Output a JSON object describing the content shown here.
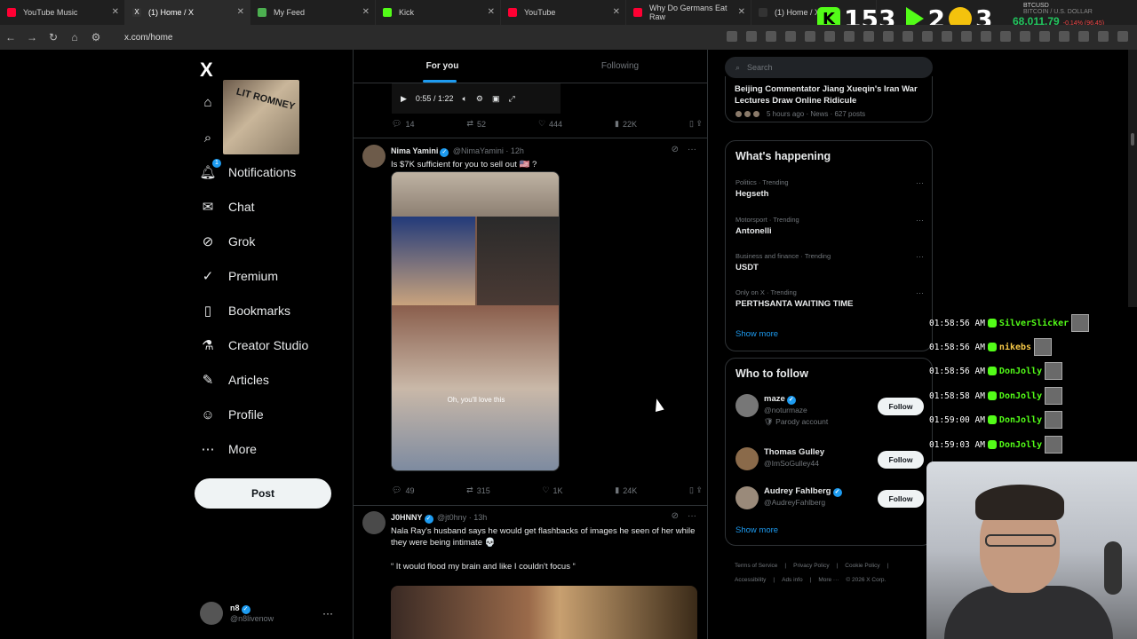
{
  "browser": {
    "tabs": [
      {
        "title": "YouTube Music",
        "color": "#ff0033"
      },
      {
        "title": "(1) Home / X",
        "color": "#e7e9ea"
      },
      {
        "title": "My Feed",
        "color": "#4caf50"
      },
      {
        "title": "Kick",
        "color": "#53fc18"
      },
      {
        "title": "YouTube",
        "color": "#ff0033"
      },
      {
        "title": "Why Do Germans Eat Raw",
        "color": "#ff0033"
      },
      {
        "title": "(1) Home / X",
        "color": "#e7e9ea"
      }
    ],
    "url": "x.com/home"
  },
  "stream_overlay": {
    "digits": "153",
    "count2": "2",
    "count3": "3",
    "btc_symbol": "BTCUSD",
    "btc_name": "BITCOIN / U.S. DOLLAR",
    "btc_price": "68,011.79",
    "btc_change": "-0.14% (96.45)"
  },
  "sidebar": {
    "logo": "X",
    "items": [
      {
        "label": "Notifications",
        "icon": "bell-icon",
        "badge": "1"
      },
      {
        "label": "Chat",
        "icon": "mail-icon"
      },
      {
        "label": "Grok",
        "icon": "grok-icon"
      },
      {
        "label": "Premium",
        "icon": "premium-icon"
      },
      {
        "label": "Bookmarks",
        "icon": "bookmark-icon"
      },
      {
        "label": "Creator Studio",
        "icon": "flask-icon"
      },
      {
        "label": "Articles",
        "icon": "article-icon"
      },
      {
        "label": "Profile",
        "icon": "person-icon"
      },
      {
        "label": "More",
        "icon": "more-circle-icon"
      }
    ],
    "overlay_image_text": "LIT ROMNEY",
    "post_button": "Post",
    "account": {
      "name": "n8",
      "handle": "@n8livenow"
    }
  },
  "feed": {
    "tabs": [
      "For you",
      "Following"
    ],
    "video_time": "0:55 / 1:22",
    "tweet0_actions": {
      "replies": "14",
      "reposts": "52",
      "likes": "444",
      "views": "22K"
    },
    "tweet1": {
      "name": "Nima Yamini",
      "handle": "@NimaYamini",
      "time": "· 12h",
      "text": "Is $7K sufficient for you to sell out 🇺🇸 ?",
      "caption": "Oh, you'll love this",
      "actions": {
        "replies": "49",
        "reposts": "315",
        "likes": "1K",
        "views": "24K"
      }
    },
    "tweet2": {
      "name": "J0HNNY",
      "handle": "@jt0hny",
      "time": "· 13h",
      "text": "Nala Ray's husband says he would get flashbacks of images he seen of her while they were being intimate 💀",
      "quote": "“ It would flood my brain and like I couldn't focus “"
    }
  },
  "right": {
    "search_placeholder": "Search",
    "news_title": "Beijing Commentator Jiang Xueqin's Iran War Lectures Draw Online Ridicule",
    "news_meta": "5 hours ago · News · 627 posts",
    "happening_title": "What's happening",
    "trends": [
      {
        "category": "Politics · Trending",
        "topic": "Hegseth"
      },
      {
        "category": "Motorsport · Trending",
        "topic": "Antonelli"
      },
      {
        "category": "Business and finance · Trending",
        "topic": "USDT"
      },
      {
        "category": "Only on X · Trending",
        "topic": "PERTHSANTA WAITING TIME"
      }
    ],
    "show_more": "Show more",
    "who_title": "Who to follow",
    "who": [
      {
        "name": "maze",
        "handle": "@noturmaze",
        "sub": "🛡 Parody account"
      },
      {
        "name": "Thomas Gulley",
        "handle": "@ImSoGulley44",
        "sub": ""
      },
      {
        "name": "Audrey Fahlberg",
        "handle": "@AudreyFahlberg",
        "sub": ""
      }
    ],
    "follow_label": "Follow",
    "footer": [
      "Terms of Service",
      "|",
      "Privacy Policy",
      "|",
      "Cookie Policy",
      "|",
      "Accessibility",
      "|",
      "Ads info",
      "|",
      "More ···",
      "© 2026 X Corp."
    ]
  },
  "chat": [
    {
      "time": "01:58:56 AM",
      "user": "SilverSlicker"
    },
    {
      "time": "01:58:56 AM",
      "user": "nikebs"
    },
    {
      "time": "01:58:56 AM",
      "user": "DonJolly"
    },
    {
      "time": "01:58:58 AM",
      "user": "DonJolly"
    },
    {
      "time": "01:59:00 AM",
      "user": "DonJolly"
    },
    {
      "time": "01:59:03 AM",
      "user": "DonJolly"
    }
  ]
}
